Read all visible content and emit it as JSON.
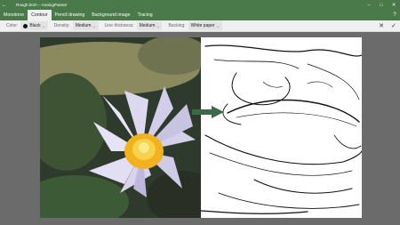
{
  "window": {
    "title": "Rough.bmh – AnalogPainter",
    "back_glyph": "←",
    "minimize_glyph": "–",
    "maximize_glyph": "□",
    "close_glyph": "✕"
  },
  "tabs": [
    {
      "label": "Monotone"
    },
    {
      "label": "Contour"
    },
    {
      "label": "Pencil drawing"
    },
    {
      "label": "Background image"
    },
    {
      "label": "Tracing"
    }
  ],
  "help_glyph": "?",
  "toolbar": {
    "color_label": "Color:",
    "color_value": "Black",
    "density_label": "Density:",
    "density_value": "Medium",
    "line_thickness_label": "Line thickness:",
    "line_thickness_value": "Medium",
    "backing_label": "Backing:",
    "backing_value": "White paper",
    "cancel_glyph": "✕",
    "apply_glyph": "✓",
    "chevron_glyph": "⌵"
  },
  "colors": {
    "accent": "#4a7a4a",
    "workspace": "#6b6b6b",
    "arrow": "#3c6a48"
  }
}
